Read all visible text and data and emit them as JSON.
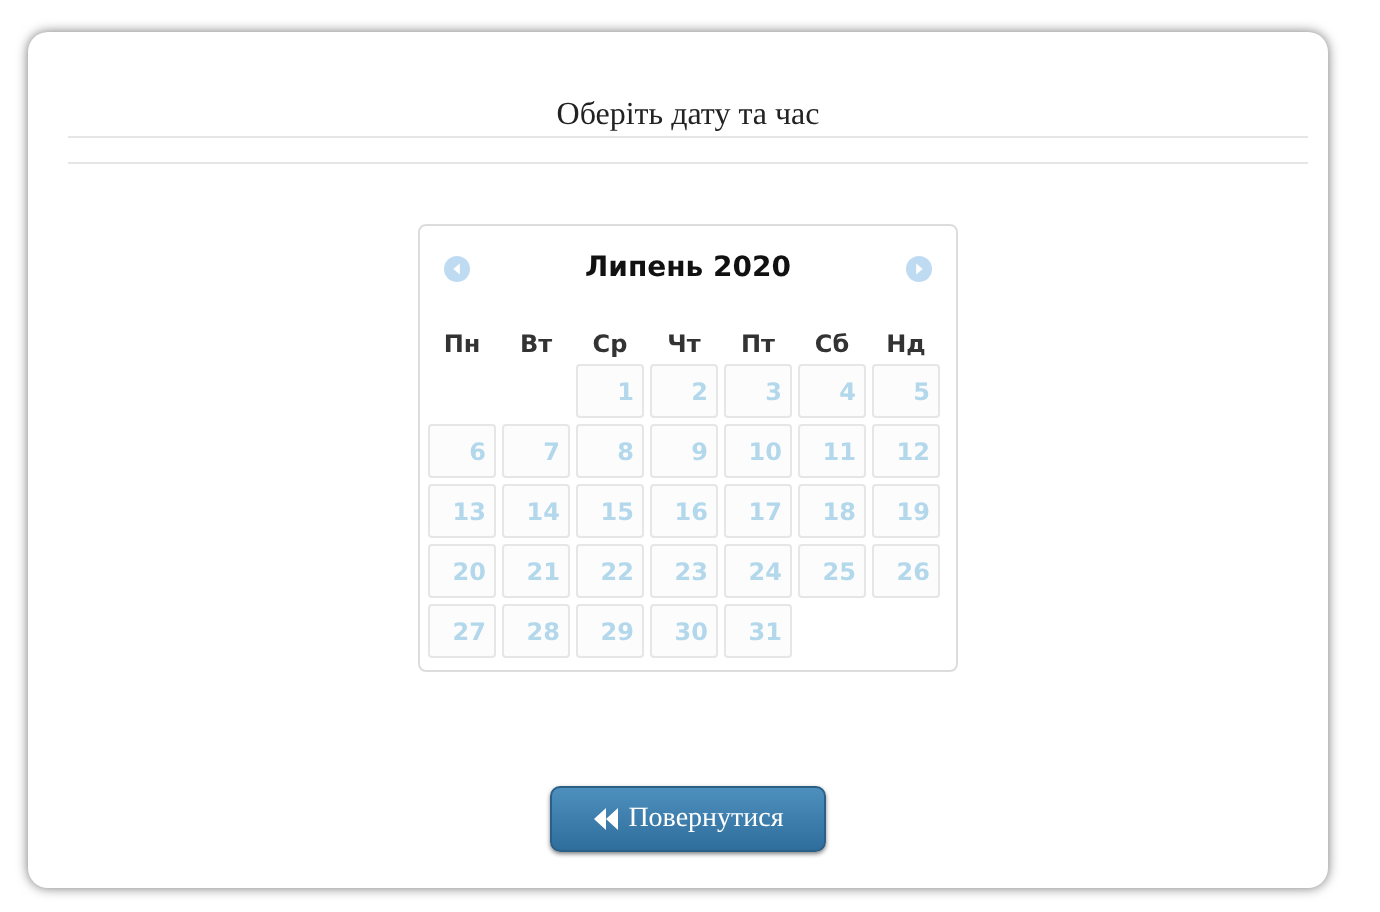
{
  "title": "Оберіть дату та час",
  "calendar": {
    "month": "Липень 2020",
    "prev_disabled": true,
    "next_disabled": true,
    "weekdays": [
      "Пн",
      "Вт",
      "Ср",
      "Чт",
      "Пт",
      "Сб",
      "Нд"
    ],
    "weeks": [
      [
        {
          "day": "1",
          "disabled": true
        },
        {
          "day": "2",
          "disabled": true
        },
        {
          "day": "3",
          "disabled": true
        },
        {
          "day": "4",
          "disabled": true
        },
        {
          "day": "5",
          "disabled": true
        }
      ],
      [
        {
          "day": "6",
          "disabled": true
        },
        {
          "day": "7",
          "disabled": true
        },
        {
          "day": "8",
          "disabled": true
        },
        {
          "day": "9",
          "disabled": true
        },
        {
          "day": "10",
          "disabled": true
        },
        {
          "day": "11",
          "disabled": true
        },
        {
          "day": "12",
          "disabled": true
        }
      ],
      [
        {
          "day": "13",
          "disabled": true
        },
        {
          "day": "14",
          "disabled": true
        },
        {
          "day": "15",
          "disabled": true
        },
        {
          "day": "16",
          "disabled": true
        },
        {
          "day": "17",
          "disabled": true
        },
        {
          "day": "18",
          "disabled": true
        },
        {
          "day": "19",
          "disabled": true
        }
      ],
      [
        {
          "day": "20",
          "disabled": true
        },
        {
          "day": "21",
          "disabled": true
        },
        {
          "day": "22",
          "disabled": true
        },
        {
          "day": "23",
          "disabled": true
        },
        {
          "day": "24",
          "disabled": true
        },
        {
          "day": "25",
          "disabled": true
        },
        {
          "day": "26",
          "disabled": true
        }
      ],
      [
        {
          "day": "27",
          "disabled": true
        },
        {
          "day": "28",
          "disabled": true
        },
        {
          "day": "29",
          "disabled": true
        },
        {
          "day": "30",
          "disabled": true
        },
        {
          "day": "31",
          "disabled": true
        }
      ]
    ]
  },
  "back_button": "Повернутися"
}
